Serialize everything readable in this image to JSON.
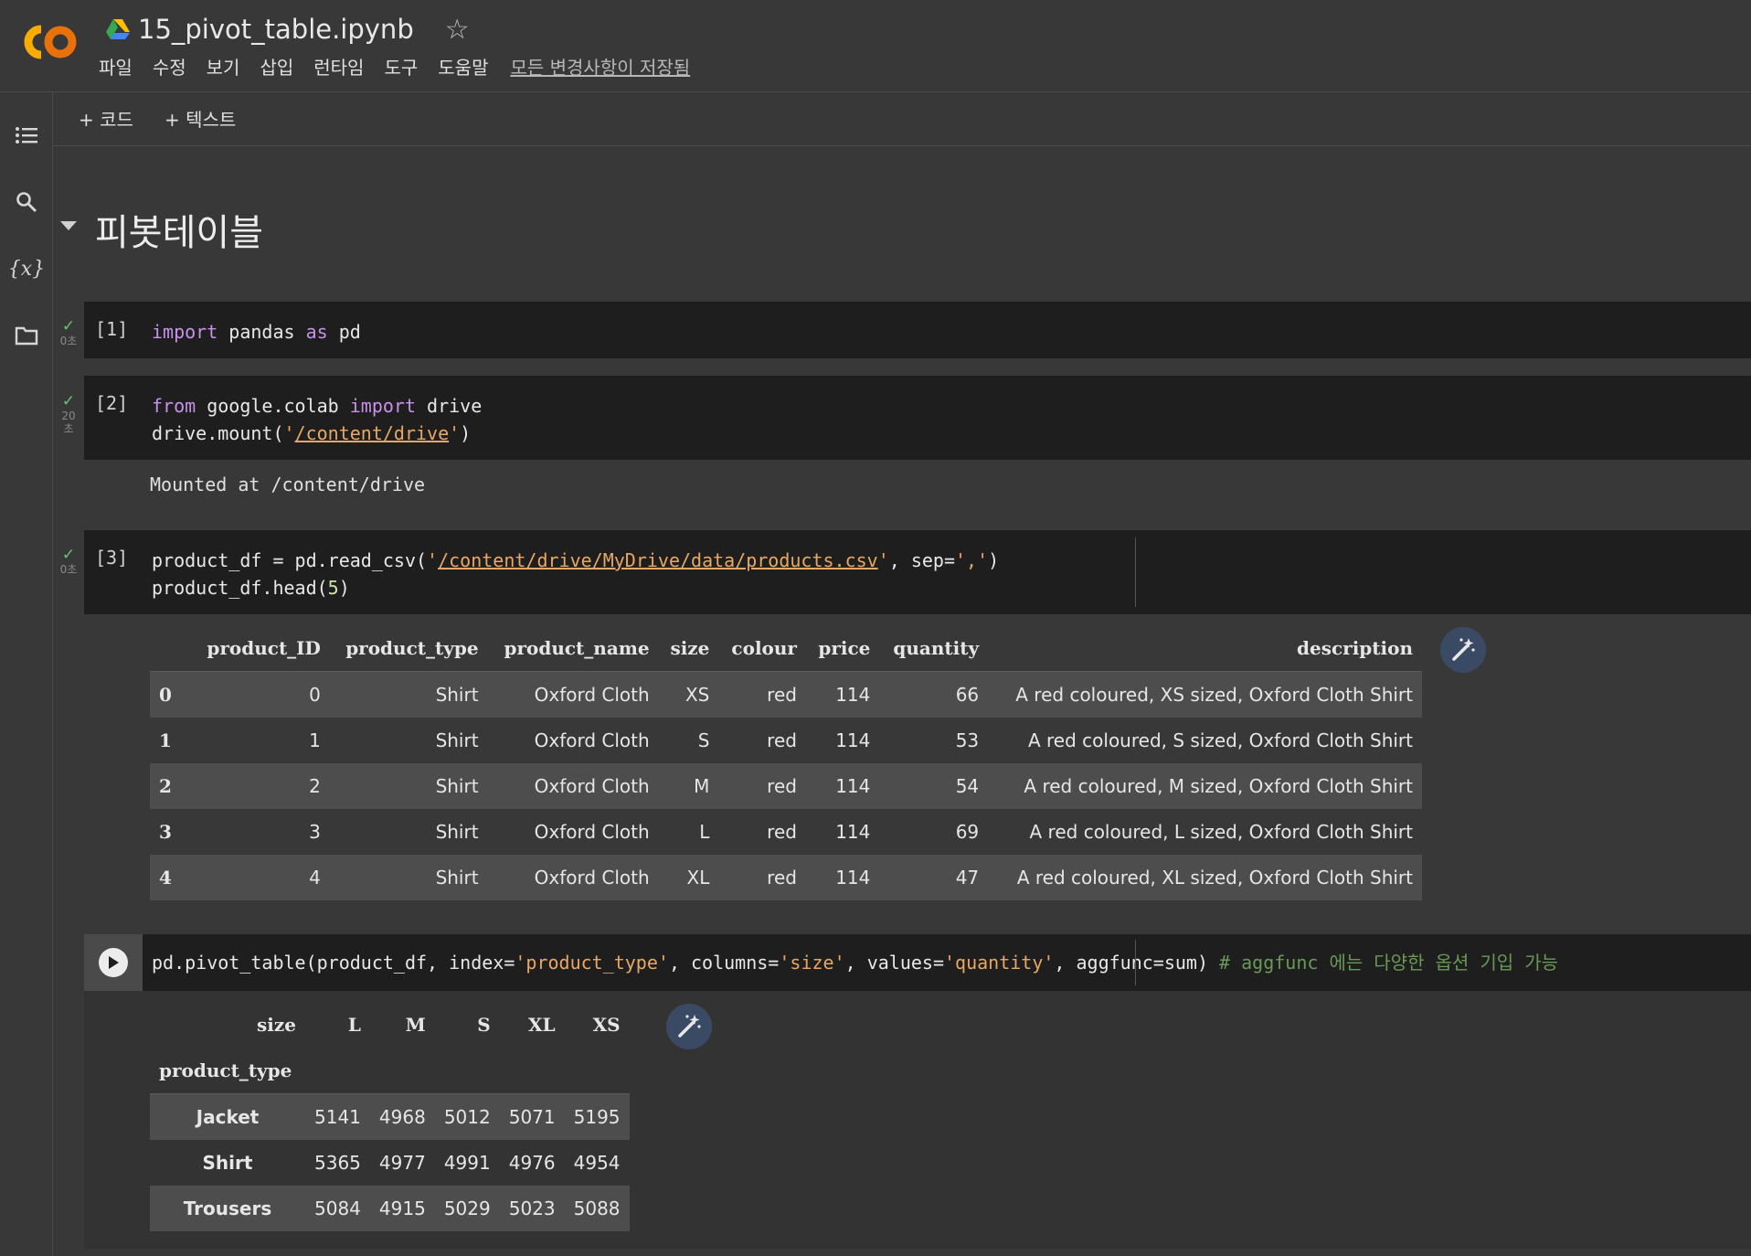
{
  "app": {
    "logo_text": "CO",
    "notebook_title": "15_pivot_table.ipynb",
    "star_glyph": "☆",
    "menu": [
      "파일",
      "수정",
      "보기",
      "삽입",
      "런타임",
      "도구",
      "도움말"
    ],
    "saved_status": "모든 변경사항이 저장됨",
    "toolbar": {
      "add_code": "+ 코드",
      "add_text": "+ 텍스트"
    },
    "rail_icons": [
      "table-of-contents-icon",
      "search-icon",
      "variables-icon",
      "files-icon"
    ],
    "variables_glyph": "{x}"
  },
  "section": {
    "title": "피봇테이블"
  },
  "cells": [
    {
      "prompt": "[1]",
      "time": "0초",
      "code_tokens": {
        "kw1": "import",
        "t1": " pandas ",
        "kw2": "as",
        "t2": " pd"
      }
    },
    {
      "prompt": "[2]",
      "time_line1": "20",
      "time_line2": "초",
      "line1": {
        "kw1": "from",
        "t1": " google.colab ",
        "kw2": "import",
        "t2": " drive"
      },
      "line2": {
        "t1": "drive.mount(",
        "q1": "'",
        "path": "/content/drive",
        "q2": "'",
        "t2": ")"
      },
      "output": "Mounted at /content/drive"
    },
    {
      "prompt": "[3]",
      "time": "0초",
      "line1": {
        "t1": "product_df = pd.read_csv(",
        "q1": "'",
        "path": "/content/drive/MyDrive/data/products.csv",
        "q2": "'",
        "t2": ", sep=",
        "sep": "','",
        "t3": ")"
      },
      "line2": {
        "t1": "product_df.head(",
        "n": "5",
        "t2": ")"
      }
    },
    {
      "line1": {
        "t1": "pd.pivot_table(product_df, index=",
        "s1": "'product_type'",
        "t2": ", columns=",
        "s2": "'size'",
        "t3": ", values=",
        "s3": "'quantity'",
        "t4": ", aggfunc=sum) ",
        "comment": "# aggfunc 에는 다양한 옵션 기입 가능"
      }
    }
  ],
  "head_table": {
    "columns": [
      "product_ID",
      "product_type",
      "product_name",
      "size",
      "colour",
      "price",
      "quantity",
      "description"
    ],
    "rows": [
      {
        "index": "0",
        "cells": [
          "0",
          "Shirt",
          "Oxford Cloth",
          "XS",
          "red",
          "114",
          "66",
          "A red coloured, XS sized, Oxford Cloth Shirt"
        ]
      },
      {
        "index": "1",
        "cells": [
          "1",
          "Shirt",
          "Oxford Cloth",
          "S",
          "red",
          "114",
          "53",
          "A red coloured, S sized, Oxford Cloth Shirt"
        ]
      },
      {
        "index": "2",
        "cells": [
          "2",
          "Shirt",
          "Oxford Cloth",
          "M",
          "red",
          "114",
          "54",
          "A red coloured, M sized, Oxford Cloth Shirt"
        ]
      },
      {
        "index": "3",
        "cells": [
          "3",
          "Shirt",
          "Oxford Cloth",
          "L",
          "red",
          "114",
          "69",
          "A red coloured, L sized, Oxford Cloth Shirt"
        ]
      },
      {
        "index": "4",
        "cells": [
          "4",
          "Shirt",
          "Oxford Cloth",
          "XL",
          "red",
          "114",
          "47",
          "A red coloured, XL sized, Oxford Cloth Shirt"
        ]
      }
    ]
  },
  "pivot_table": {
    "columns_name": "size",
    "columns": [
      "L",
      "M",
      "S",
      "XL",
      "XS"
    ],
    "index_name": "product_type",
    "rows": [
      {
        "index": "Jacket",
        "cells": [
          "5141",
          "4968",
          "5012",
          "5071",
          "5195"
        ]
      },
      {
        "index": "Shirt",
        "cells": [
          "5365",
          "4977",
          "4991",
          "4976",
          "4954"
        ]
      },
      {
        "index": "Trousers",
        "cells": [
          "5084",
          "4915",
          "5029",
          "5023",
          "5088"
        ]
      }
    ]
  },
  "colors": {
    "accent_orange": "#F9AB00",
    "string": "#e8a865",
    "keyword": "#c792ea",
    "comment": "#6a9955",
    "check": "#6fbf73"
  }
}
